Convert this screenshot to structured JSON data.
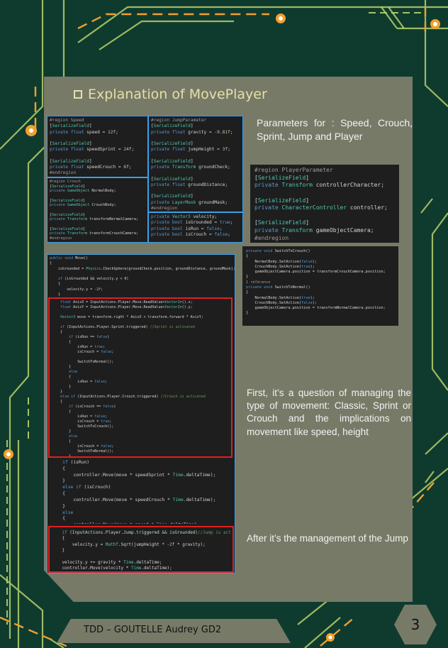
{
  "title": "Explanation of MovePlayer",
  "descriptions": {
    "params": "Parameters for : Speed, Crouch, Sprint, Jump and Player",
    "movement": "First, it’s a question of managing the type of movement: Classic, Sprint or Crouch and the implications on movement like speed, height",
    "jump": "After it’s the management of the Jump"
  },
  "footer": "TDD – GOUTELLE Audrey GD2",
  "page_number": "3",
  "colors": {
    "background": "#0f3b2e",
    "panel": "#787a68",
    "accent": "#f0a030",
    "circuit": "#b7d16b",
    "highlight_blue": "#3aa0e8",
    "highlight_red": "#e02020"
  },
  "code": {
    "speed": "#region Speed\n[SerializeField]\nprivate float speed = 12f;\n\n[SerializeField]\nprivate float speedSprint = 24f;\n\n[SerializeField]\nprivate float speedCrouch = 6f;\n#endregion",
    "crouch": "#region Crouch\n[SerializeField]\nprivate GameObject NormalBody;\n\n[SerializeField]\nprivate GameObject CrouchBody;\n\n[SerializeField]\nprivate Transform transformNormalCamera;\n\n[SerializeField]\nprivate Transform transformCrouchCamera;\n#endregion",
    "jump_params": "#region JumpParameter\n[SerializeField]\nprivate float gravity = -9.81f;\n\n[SerializeField]\nprivate float jumpHeight = 3f;\n\n[SerializeField]\nprivate Transform groundCheck;\n\n[SerializeField]\nprivate float groundDistance;\n\n[SerializeField]\nprivate LayerMask groundMask;\n#endregion",
    "vars": "private Vector3 velocity;\nprivate bool isGrounded = true;\nprivate bool isRun = false;\nprivate bool isCrouch = false;",
    "player_params": "#region PlayerParameter\n[SerializeField]\nprivate Transform controllerCharacter;\n\n[SerializeField]\nprivate CharacterController controller;\n\n[SerializeField]\nprivate Transform gameObjectCamera;\n#endregion",
    "switch": "private void SwitchToCrouch()\n{\n    NormalBody.SetActive(false);\n    CrouchBody.SetActive(true);\n    gameObjectCamera.position = transformCrouchCamera.position;\n}\n1 référence\nprivate void SwitchToNormal()\n{\n    NormalBody.SetActive(true);\n    CrouchBody.SetActive(false);\n    gameObjectCamera.position = transformNormalCamera.position;\n}",
    "move_top": "public void Move()\n{\n    isGrounded = Physics.CheckSphere(groundCheck.position, groundDistance, groundMask);\n\n    if (isGrounded && velocity.y < 0)\n    {\n        velocity.y = -2f;\n    }",
    "move_mid": "    float AxisX = InputActions.Player.Move.ReadValue<Vector2>().x;\n    float AxisY = InputActions.Player.Move.ReadValue<Vector2>().y;\n\n    Vector3 move = transform.right * AxisX + transform.forward * AxisY;\n\n    if (InputActions.Player.Sprint.triggered) //Sprint is activated\n    {\n        if (isRun == false)\n        {\n            isRun = true;\n            isCrouch = false;\n\n            SwitchToNormal();\n        }\n        else\n        {\n            isRun = false;\n        }\n    }\n    else if (InputActions.Player.Crouch.triggered) //Crouch is activated\n    {\n        if (isCrouch == false)\n        {\n            isRun = false;\n            isCrouch = true;\n            SwitchToCrouch();\n        }\n        else\n        {\n            isCrouch = false;\n            SwitchToNormal();\n        }\n    }",
    "move_speed": "    if (isRun)\n    {\n        controller.Move(move * speedSprint * Time.deltaTime);\n    }\n    else if (isCrouch)\n    {\n        controller.Move(move * speedCrouch * Time.deltaTime);\n    }\n    else\n    {\n        controller.Move(move * speed * Time.deltaTime);\n    }",
    "move_jump": "    if (InputActions.Player.Jump.triggered && isGrounded)//Jump is activated\n    {\n        velocity.y = Mathf.Sqrt(jumpHeight * -2f * gravity);\n    }\n\n    velocity.y += gravity * Time.deltaTime;\n    controller.Move(velocity * Time.deltaTime);\n}"
  }
}
